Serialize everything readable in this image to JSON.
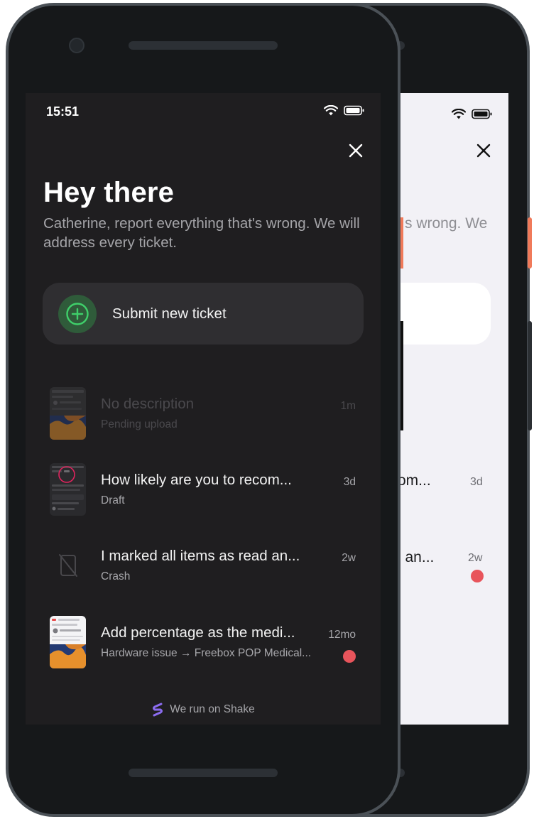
{
  "status_bar": {
    "time": "15:51"
  },
  "header": {
    "greeting": "Hey there",
    "intro": "Catherine, report everything that's wrong. We will address every ticket."
  },
  "submit": {
    "label": "Submit new ticket"
  },
  "tickets": [
    {
      "title": "No description",
      "subtitle": "Pending upload",
      "age": "1m",
      "unread": false,
      "state": "pending",
      "thumb": "screenshot-map"
    },
    {
      "title": "How likely are you to recom...",
      "subtitle": "Draft",
      "age": "3d",
      "unread": false,
      "state": "draft",
      "thumb": "screenshot-dark-ui"
    },
    {
      "title": "I marked all items as read an...",
      "subtitle": "Crash",
      "age": "2w",
      "unread": true,
      "state": "crash",
      "thumb": "no-screenshot-icon"
    },
    {
      "title": "Add percentage as the medi...",
      "subtitle": "Hardware issue → Freebox POP Medical...",
      "age": "12mo",
      "unread": true,
      "state": "normal",
      "thumb": "screenshot-map-light"
    }
  ],
  "back_screen": {
    "intro_fragment": "s wrong. We",
    "rows": [
      {
        "title_fragment": "om...",
        "age": "3d",
        "unread": false
      },
      {
        "title_fragment": "l an...",
        "age": "2w",
        "unread": true
      }
    ]
  },
  "footer": {
    "label": "We run on Shake"
  },
  "colors": {
    "screen_bg": "#1f1e20",
    "card_bg": "#2f2e31",
    "accent_green": "#3fcf6a",
    "unread_dot": "#e8545b",
    "phone_frame": "#16181a",
    "back_screen_bg": "#f2f1f6",
    "side_button": "#f07a5a"
  }
}
